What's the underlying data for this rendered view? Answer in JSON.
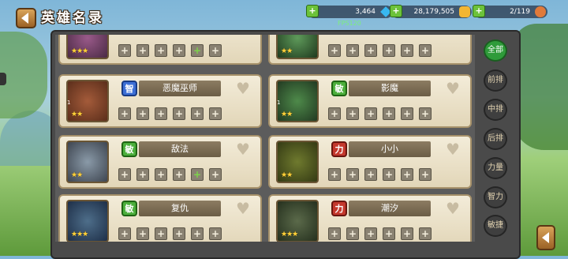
{
  "header": {
    "title": "英雄名录"
  },
  "resources": [
    {
      "value": "3,464",
      "icon": "diamond-icon"
    },
    {
      "value": "28,179,505",
      "icon": "gold-icon"
    },
    {
      "value": "2/119",
      "icon": "potion-icon"
    }
  ],
  "fps": "FPS120",
  "tabs": [
    "全部",
    "前排",
    "中排",
    "后排",
    "力量",
    "智力",
    "敏捷"
  ],
  "heroes": [
    {
      "name": "",
      "attr": "",
      "stars": "★★★"
    },
    {
      "name": "",
      "attr": "",
      "stars": "★★"
    },
    {
      "name": "恶魔巫师",
      "attr": "智",
      "stars": "★★"
    },
    {
      "name": "影魔",
      "attr": "敏",
      "stars": "★★"
    },
    {
      "name": "敌法",
      "attr": "敏",
      "stars": "★★"
    },
    {
      "name": "小小",
      "attr": "力",
      "stars": "★★"
    },
    {
      "name": "复仇",
      "attr": "敏",
      "stars": "★★★"
    },
    {
      "name": "潮汐",
      "attr": "力",
      "stars": "★★★"
    }
  ],
  "slot_symbol": "+"
}
